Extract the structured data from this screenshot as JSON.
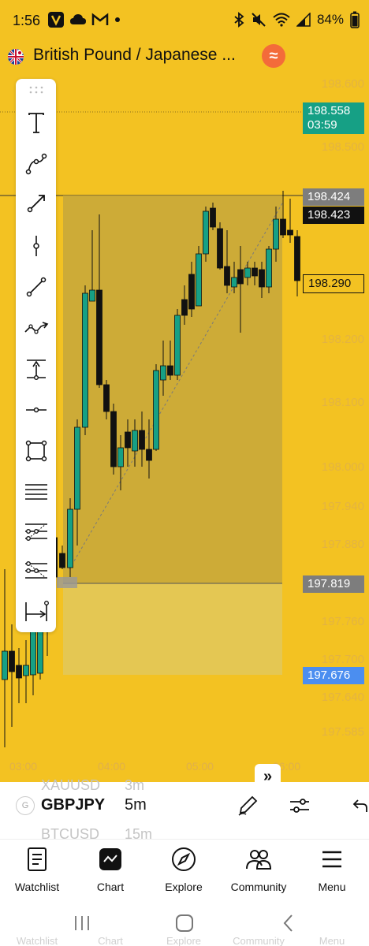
{
  "status_bar": {
    "time": "1:56",
    "battery": "84%",
    "icons": [
      "v-app-icon",
      "cloud-icon",
      "gmail-icon",
      "dot-icon",
      "bluetooth-icon",
      "mute-icon",
      "wifi-icon",
      "signal-icon",
      "battery-icon"
    ]
  },
  "header": {
    "title": "British Pound / Japanese ...",
    "flag_icon": "gbp-jpy-flag-icon",
    "indicator_icon": "indicator-icon"
  },
  "chart": {
    "price_axis": [
      "198.600",
      "198.500",
      "198.200",
      "198.100",
      "198.000",
      "197.940",
      "197.880",
      "197.760",
      "197.700",
      "197.640",
      "197.585"
    ],
    "badges": {
      "current_price": "198.558",
      "countdown": "03:59",
      "high_line": "198.424",
      "crosshair": "198.423",
      "last_close": "198.290",
      "entry": "197.819",
      "stop": "197.676"
    },
    "time_axis": [
      "03:00",
      "04:00",
      "05:00",
      "06:00"
    ],
    "colors": {
      "background": "#f3c222",
      "up_candle": "#16a085",
      "down_candle": "#111111",
      "profit_zone": "#c9a93a",
      "loss_zone": "#e0c860",
      "current_price_badge": "#16a085",
      "stop_badge": "#4b8ef0"
    }
  },
  "toolbar": {
    "tools": [
      "text-tool-icon",
      "curve-tool-icon",
      "arrow-line-tool-icon",
      "vertical-line-tool-icon",
      "trend-line-tool-icon",
      "polyline-arrow-tool-icon",
      "measure-tool-icon",
      "horizontal-line-tool-icon",
      "rectangle-tool-icon",
      "parallel-lines-tool-icon",
      "fib-fan-tool-icon",
      "fib-channel-tool-icon",
      "date-range-tool-icon"
    ]
  },
  "picker": {
    "prev_symbol": "XAUUSD",
    "prev_interval": "3m",
    "badge": "G",
    "symbol": "GBPJPY",
    "interval": "5m",
    "next_symbol": "BTCUSD",
    "next_interval": "15m"
  },
  "bottom_nav": {
    "items": [
      {
        "label": "Watchlist",
        "icon": "watchlist-icon"
      },
      {
        "label": "Chart",
        "icon": "chart-icon"
      },
      {
        "label": "Explore",
        "icon": "compass-icon"
      },
      {
        "label": "Community",
        "icon": "community-icon"
      },
      {
        "label": "Menu",
        "icon": "hamburger-menu-icon"
      }
    ]
  }
}
